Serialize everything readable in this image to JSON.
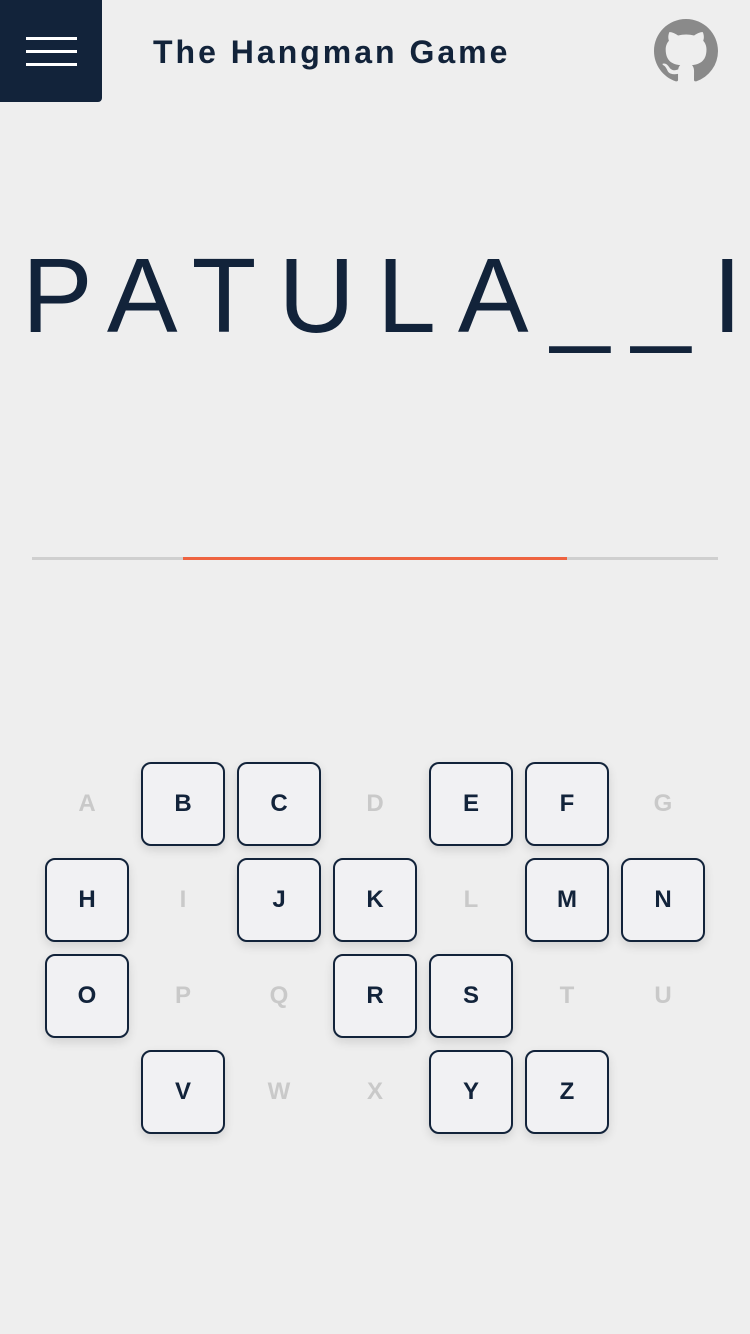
{
  "header": {
    "title": "The Hangman Game",
    "menu_icon": "hamburger-menu-icon",
    "github_icon": "github-icon"
  },
  "game": {
    "word_display": "PATULA__I",
    "progress": {
      "start": 0.22,
      "end": 0.78
    }
  },
  "colors": {
    "primary": "#12233a",
    "background": "#eeeeee",
    "accent": "#ee6340",
    "disabled": "#c9c9c9",
    "track": "#cfcfcf"
  },
  "keyboard": {
    "rows": [
      [
        {
          "letter": "A",
          "state": "used"
        },
        {
          "letter": "B",
          "state": "active"
        },
        {
          "letter": "C",
          "state": "active"
        },
        {
          "letter": "D",
          "state": "used"
        },
        {
          "letter": "E",
          "state": "active"
        },
        {
          "letter": "F",
          "state": "active"
        },
        {
          "letter": "G",
          "state": "used"
        }
      ],
      [
        {
          "letter": "H",
          "state": "active"
        },
        {
          "letter": "I",
          "state": "used"
        },
        {
          "letter": "J",
          "state": "active"
        },
        {
          "letter": "K",
          "state": "active"
        },
        {
          "letter": "L",
          "state": "used"
        },
        {
          "letter": "M",
          "state": "active"
        },
        {
          "letter": "N",
          "state": "active"
        }
      ],
      [
        {
          "letter": "O",
          "state": "active"
        },
        {
          "letter": "P",
          "state": "used"
        },
        {
          "letter": "Q",
          "state": "used"
        },
        {
          "letter": "R",
          "state": "active"
        },
        {
          "letter": "S",
          "state": "active"
        },
        {
          "letter": "T",
          "state": "used"
        },
        {
          "letter": "U",
          "state": "used"
        }
      ],
      [
        {
          "letter": "V",
          "state": "active"
        },
        {
          "letter": "W",
          "state": "used"
        },
        {
          "letter": "X",
          "state": "used"
        },
        {
          "letter": "Y",
          "state": "active"
        },
        {
          "letter": "Z",
          "state": "active"
        }
      ]
    ]
  }
}
